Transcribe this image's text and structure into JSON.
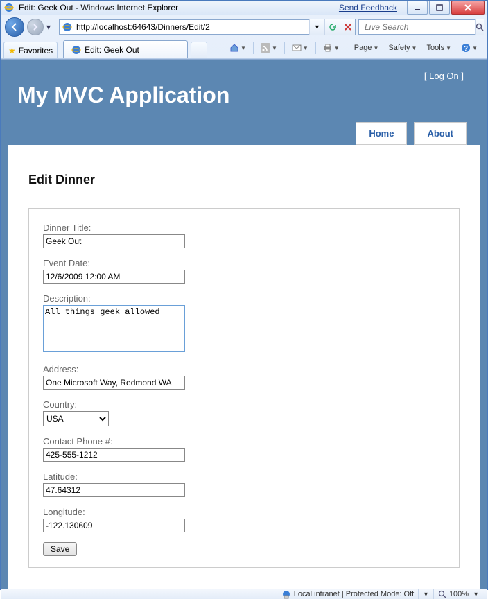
{
  "window": {
    "title": "Edit: Geek Out - Windows Internet Explorer",
    "feedback": "Send Feedback"
  },
  "address": {
    "url": "http://localhost:64643/Dinners/Edit/2"
  },
  "search": {
    "placeholder": "Live Search"
  },
  "favorites_label": "Favorites",
  "tab": {
    "title": "Edit: Geek Out"
  },
  "cmdbar": {
    "page": "Page",
    "safety": "Safety",
    "tools": "Tools"
  },
  "header": {
    "logon_open": "[ ",
    "logon_link": "Log On",
    "logon_close": " ]",
    "app_title": "My MVC Application",
    "nav": {
      "home": "Home",
      "about": "About"
    }
  },
  "page": {
    "heading": "Edit Dinner",
    "labels": {
      "title": "Dinner Title:",
      "event_date": "Event Date:",
      "description": "Description:",
      "address": "Address:",
      "country": "Country:",
      "contact_phone": "Contact Phone #:",
      "latitude": "Latitude:",
      "longitude": "Longitude:"
    },
    "values": {
      "title": "Geek Out",
      "event_date": "12/6/2009 12:00 AM",
      "description": "All things geek allowed",
      "address": "One Microsoft Way, Redmond WA",
      "country": "USA",
      "contact_phone": "425-555-1212",
      "latitude": "47.64312",
      "longitude": "-122.130609"
    },
    "save": "Save"
  },
  "status": {
    "zone": "Local intranet | Protected Mode: Off",
    "zoom": "100%"
  }
}
